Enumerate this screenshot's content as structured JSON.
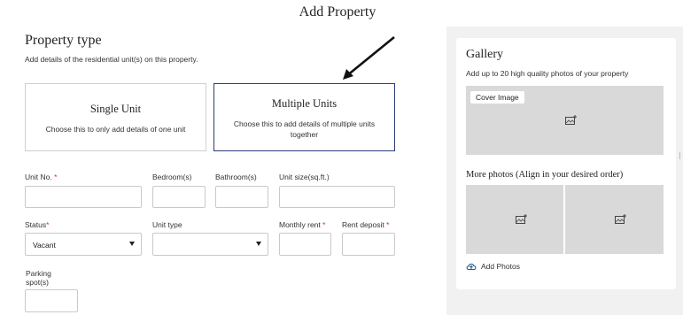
{
  "page_title": "Add Property",
  "property_type": {
    "title": "Property type",
    "subtitle": "Add details of the residential unit(s) on this property.",
    "options": [
      {
        "title": "Single Unit",
        "desc": "Choose this to only add details of one unit"
      },
      {
        "title": "Multiple Units",
        "desc": "Choose this to add details of multiple units together"
      }
    ],
    "selected": "Multiple Units"
  },
  "fields": {
    "unit_no": {
      "label": "Unit No.",
      "required_mark": "*",
      "value": ""
    },
    "bedrooms": {
      "label": "Bedroom(s)",
      "value": ""
    },
    "bathrooms": {
      "label": "Bathroom(s)",
      "value": ""
    },
    "unit_size": {
      "label": "Unit size(sq.ft.)",
      "value": ""
    },
    "status": {
      "label": "Status",
      "required_mark": "*",
      "value": "Vacant"
    },
    "unit_type": {
      "label": "Unit type",
      "value": ""
    },
    "monthly_rent": {
      "label": "Monthly rent",
      "required_mark": "*",
      "value": ""
    },
    "rent_deposit": {
      "label": "Rent deposit",
      "required_mark": "*",
      "value": ""
    },
    "parking": {
      "label_line1": "Parking",
      "label_line2": "spot(s)",
      "value": ""
    }
  },
  "gallery": {
    "title": "Gallery",
    "subtitle": "Add up to 20 high quality photos of your property",
    "cover_label": "Cover Image",
    "more_title": "More photos (Align in your desired order)",
    "add_photos_label": "Add Photos"
  },
  "colors": {
    "selected_border": "#2c3e7a",
    "required": "#c0392b",
    "placeholder_bg": "#d9d9d9",
    "panel_bg": "#f1f1f1"
  },
  "icons": {
    "image_placeholder": "image-add-icon",
    "add_photos": "cloud-upload-icon",
    "select": "chevron-down-icon"
  }
}
